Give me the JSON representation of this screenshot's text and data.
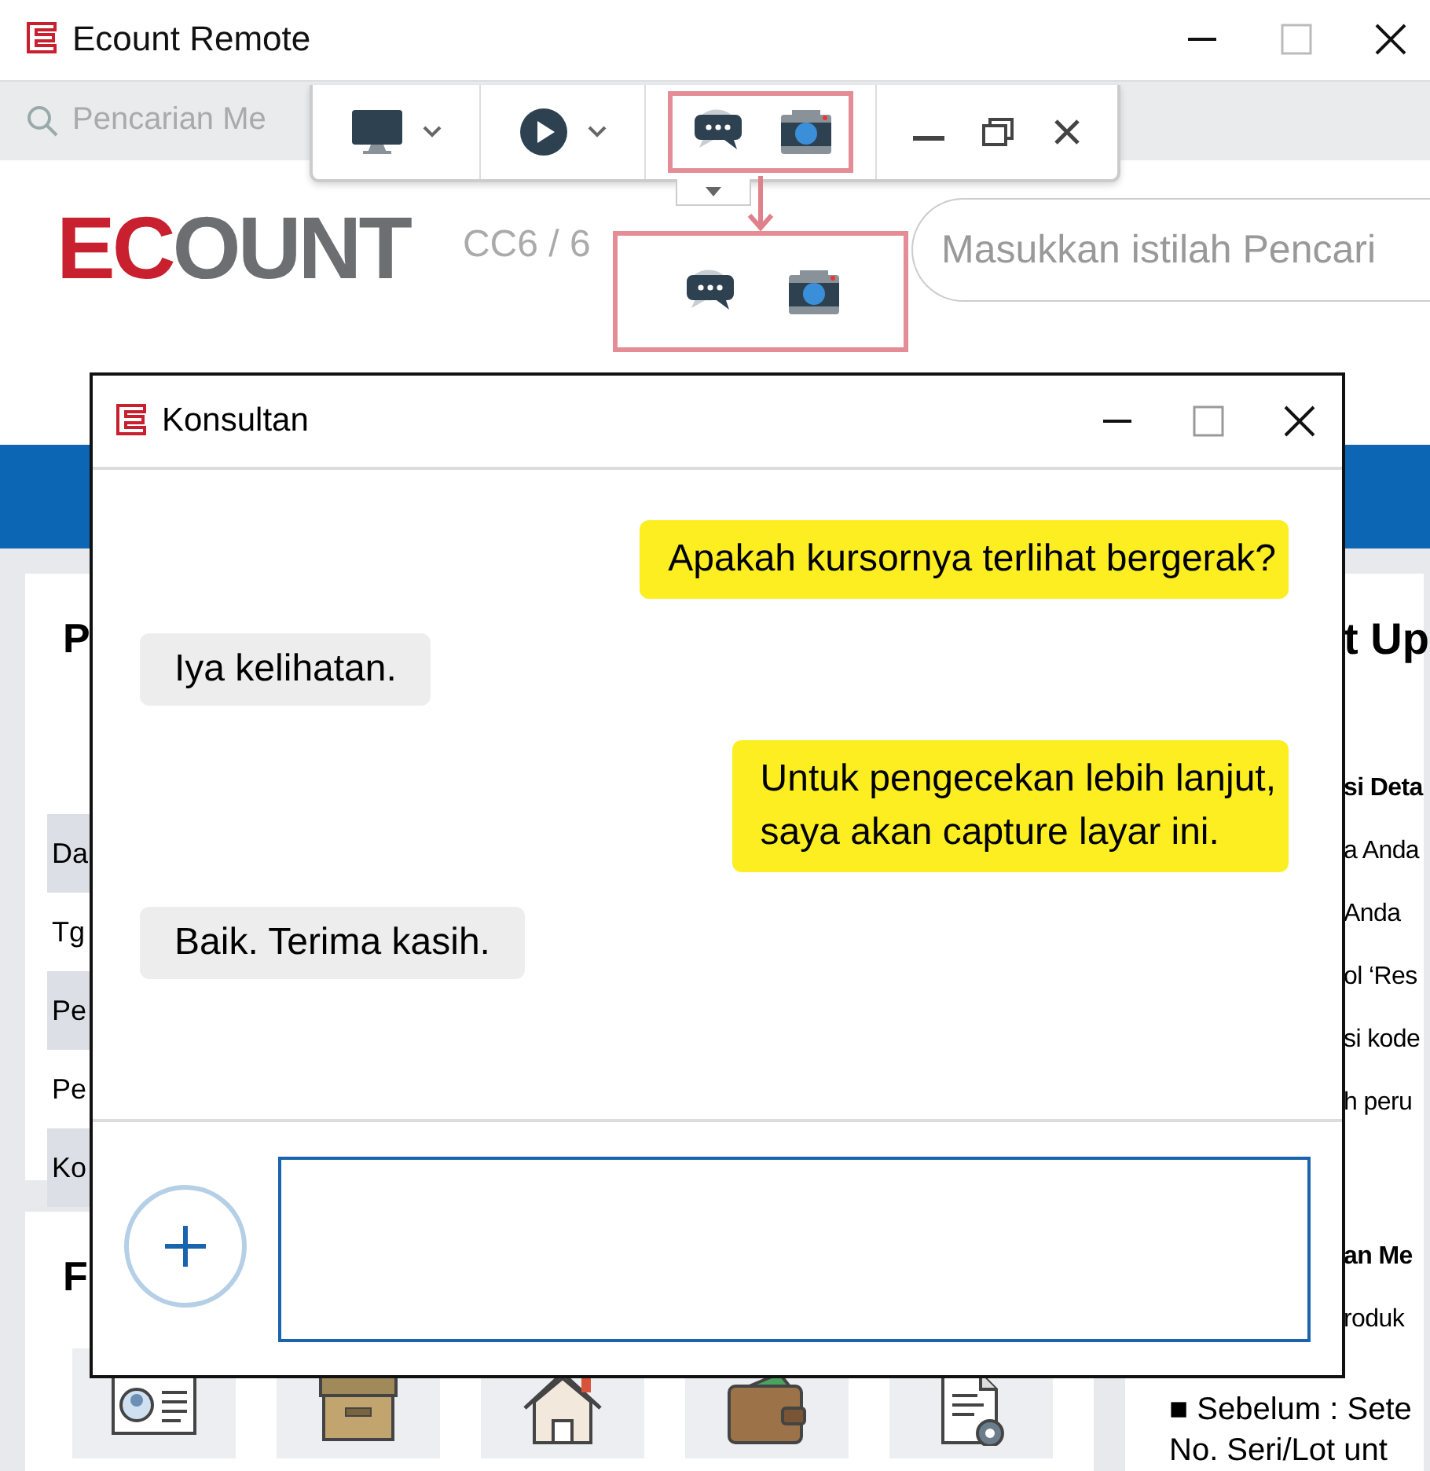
{
  "window": {
    "title": "Ecount Remote"
  },
  "menu_search": {
    "placeholder": "Pencarian Me"
  },
  "header": {
    "logo": [
      {
        "text": "EC",
        "color": "#c8202f"
      },
      {
        "text": "OUNT",
        "color": "#6d6e71"
      }
    ],
    "company": "CC6 / 6",
    "search": {
      "placeholder": "Masukkan istilah Pencari"
    }
  },
  "left_panel": {
    "heading": "P",
    "rows": [
      {
        "label": "Da",
        "shaded": true
      },
      {
        "label": "Tg",
        "shaded": false
      },
      {
        "label": "Pe",
        "shaded": true
      },
      {
        "label": "Pe",
        "shaded": false
      },
      {
        "label": "Ko",
        "shaded": true
      }
    ]
  },
  "favorites": {
    "heading": "F",
    "tiles": [
      {
        "kind": "contact"
      },
      {
        "kind": "box"
      },
      {
        "kind": "house"
      },
      {
        "kind": "wallet"
      },
      {
        "kind": "document"
      }
    ]
  },
  "right_panel": {
    "heading": "t Up",
    "sections": [
      {
        "lines": [
          {
            "text": "si Deta",
            "bold": true
          },
          {
            "text": "a Anda",
            "bold": false
          },
          {
            "text": "Anda",
            "bold": false
          },
          {
            "text": "ol ‘Res",
            "bold": false
          },
          {
            "text": "si kode",
            "bold": false
          },
          {
            "text": "h peru",
            "bold": false
          }
        ]
      },
      {
        "lines": [
          {
            "text": "an Me",
            "bold": true
          },
          {
            "text": "roduk",
            "bold": false
          }
        ]
      }
    ],
    "footer_lines": [
      "■ Sebelum : Sete",
      "No. Seri/Lot unt"
    ]
  },
  "chat": {
    "title": "Konsultan",
    "messages": [
      {
        "kind": "sent",
        "text": "Apakah kursornya terlihat bergerak?"
      },
      {
        "kind": "received",
        "text": "Iya kelihatan."
      },
      {
        "kind": "sent",
        "text": "Untuk pengecekan lebih lanjut,\nsaya akan capture layar ini."
      },
      {
        "kind": "received",
        "text": "Baik. Terima kasih."
      }
    ]
  }
}
